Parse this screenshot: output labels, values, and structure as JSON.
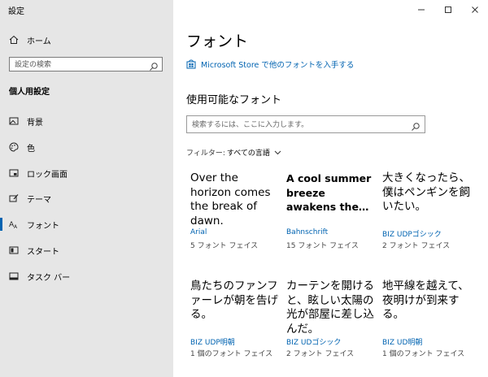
{
  "app_title": "設定",
  "sidebar": {
    "home_label": "ホーム",
    "search_placeholder": "設定の検索",
    "section_header": "個人用設定",
    "items": [
      {
        "label": "背景",
        "icon": "picture-icon"
      },
      {
        "label": "色",
        "icon": "palette-icon"
      },
      {
        "label": "ロック画面",
        "icon": "lock-screen-icon"
      },
      {
        "label": "テーマ",
        "icon": "theme-brush-icon"
      },
      {
        "label": "フォント",
        "icon": "font-aa-icon",
        "selected": true
      },
      {
        "label": "スタート",
        "icon": "start-icon"
      },
      {
        "label": "タスク バー",
        "icon": "taskbar-icon"
      }
    ]
  },
  "main": {
    "title": "フォント",
    "store_link": "Microsoft Store で他のフォントを入手する",
    "available_header": "使用可能なフォント",
    "font_search_placeholder": "検索するには、ここに入力します。",
    "filter_label": "フィルター:",
    "filter_value": "すべての言語",
    "fonts": [
      {
        "sample": "Over the horizon comes the break of dawn.",
        "name": "Arial",
        "faces": "5 フォント フェイス"
      },
      {
        "sample": "A cool summer breeze awakens the…",
        "name": "Bahnschrift",
        "faces": "15 フォント フェイス"
      },
      {
        "sample": "大きくなったら、僕はペンギンを飼いたい。",
        "name": "BIZ UDPゴシック",
        "faces": "2 フォント フェイス"
      },
      {
        "sample": "鳥たちのファンファーレが朝を告げる。",
        "name": "BIZ UDP明朝",
        "faces": "1 個のフォント フェイス"
      },
      {
        "sample": "カーテンを開けると、眩しい太陽の光が部屋に差し込んだ。",
        "name": "BIZ UDゴシック",
        "faces": "2 フォント フェイス"
      },
      {
        "sample": "地平線を越えて、夜明けが到来する。",
        "name": "BIZ UD明朝",
        "faces": "1 個のフォント フェイス"
      }
    ]
  },
  "colors": {
    "accent": "#0063b1",
    "sidebar_bg": "#e6e6e6"
  }
}
